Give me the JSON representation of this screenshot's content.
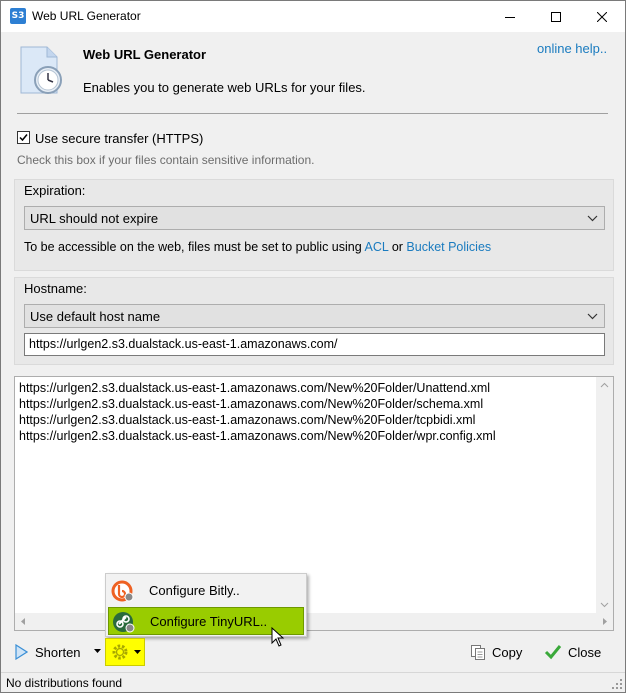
{
  "window": {
    "title": "Web URL Generator"
  },
  "header": {
    "title": "Web URL Generator",
    "description": "Enables you to generate web URLs for your files.",
    "help_link": "online help.."
  },
  "secure": {
    "label": "Use secure transfer (HTTPS)",
    "checked": true,
    "hint": "Check this box if your files contain sensitive information."
  },
  "expiration": {
    "label": "Expiration:",
    "selected": "URL should not expire",
    "note_prefix": "To be accessible on the web, files must be set to public using ",
    "note_link1": "ACL",
    "note_or": " or ",
    "note_link2": "Bucket Policies"
  },
  "hostname": {
    "label": "Hostname:",
    "selected": "Use default host name",
    "value": "https://urlgen2.s3.dualstack.us-east-1.amazonaws.com/"
  },
  "urls": [
    "https://urlgen2.s3.dualstack.us-east-1.amazonaws.com/New%20Folder/Unattend.xml",
    "https://urlgen2.s3.dualstack.us-east-1.amazonaws.com/New%20Folder/schema.xml",
    "https://urlgen2.s3.dualstack.us-east-1.amazonaws.com/New%20Folder/tcpbidi.xml",
    "https://urlgen2.s3.dualstack.us-east-1.amazonaws.com/New%20Folder/wpr.config.xml"
  ],
  "menu": {
    "items": [
      {
        "label": "Configure Bitly..",
        "icon": "bitly-icon"
      },
      {
        "label": "Configure TinyURL..",
        "icon": "tinyurl-icon",
        "highlighted": true
      }
    ]
  },
  "toolbar": {
    "shorten_label": "Shorten",
    "copy_label": "Copy",
    "close_label": "Close"
  },
  "status": {
    "text": "No distributions found"
  },
  "colors": {
    "accent_link": "#1a7bbf",
    "menu_highlight": "#99cc00",
    "settings_highlight": "#ffff00"
  }
}
